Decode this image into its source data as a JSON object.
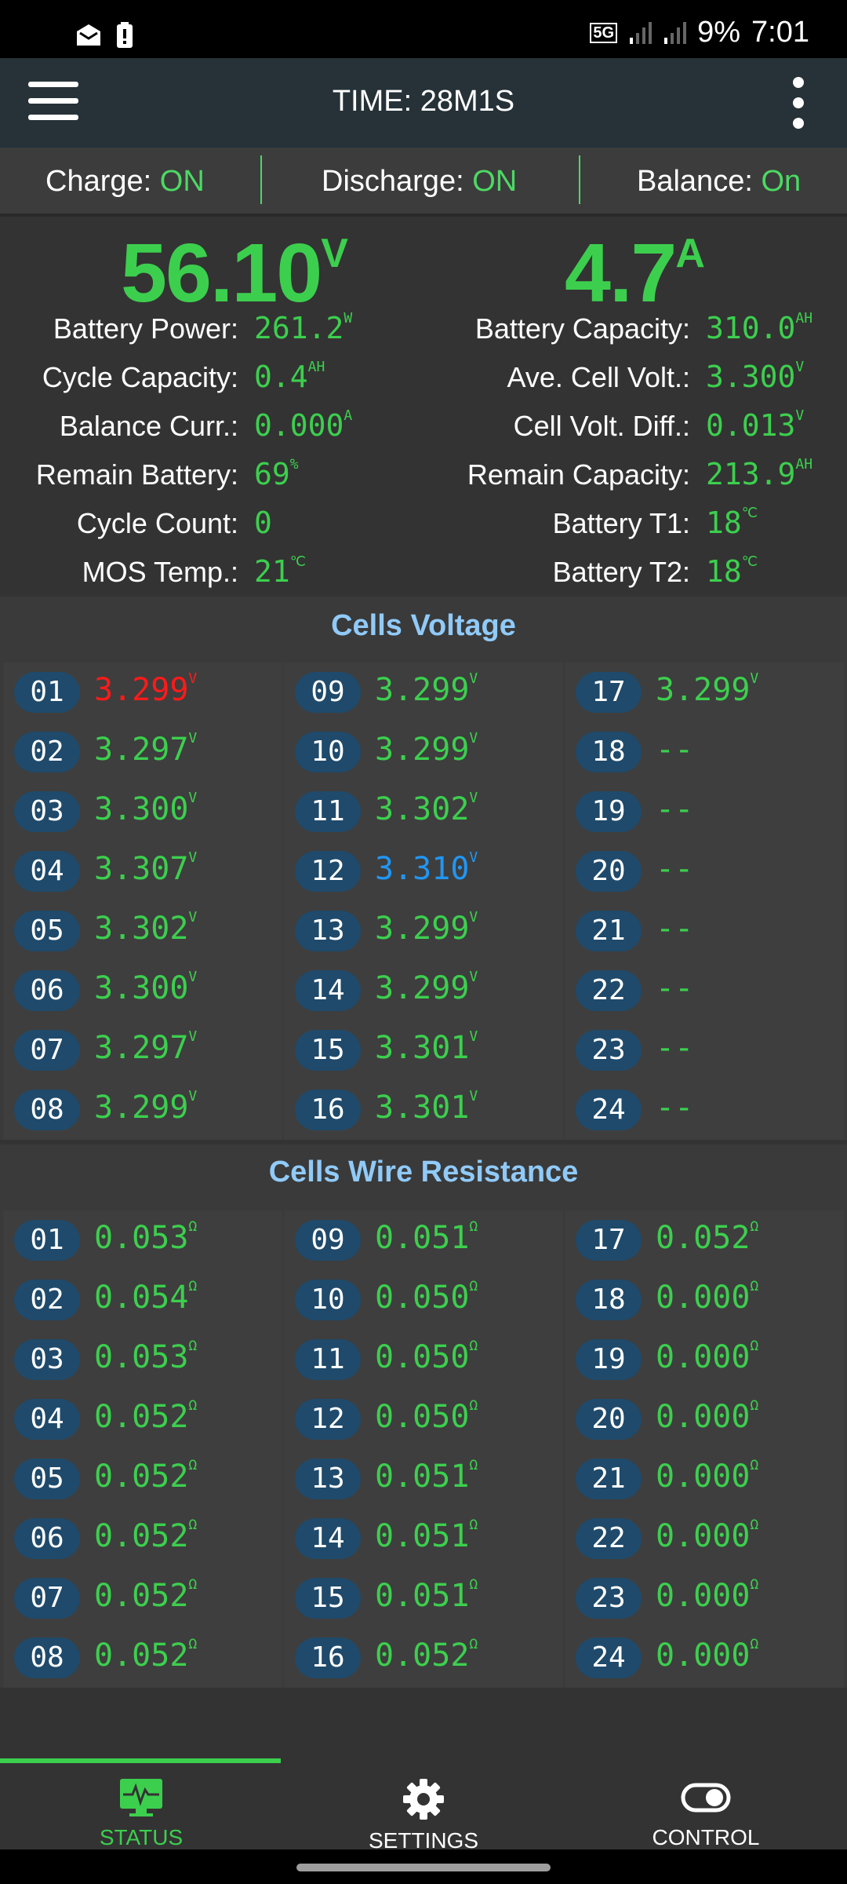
{
  "statusbar": {
    "network": "5G",
    "battery": "9%",
    "time": "7:01"
  },
  "appbar": {
    "title": "TIME: 28M1S"
  },
  "switches": {
    "charge_label": "Charge:",
    "charge_value": "ON",
    "discharge_label": "Discharge:",
    "discharge_value": "ON",
    "balance_label": "Balance:",
    "balance_value": "On"
  },
  "readings": {
    "voltage": "56.10",
    "voltage_unit": "V",
    "current": "4.7",
    "current_unit": "A"
  },
  "left_stats": [
    {
      "label": "Battery Power:",
      "value": "261.2",
      "unit": "W"
    },
    {
      "label": "Cycle Capacity:",
      "value": "0.4",
      "unit": "AH"
    },
    {
      "label": "Balance Curr.:",
      "value": "0.000",
      "unit": "A"
    },
    {
      "label": "Remain Battery:",
      "value": "69",
      "unit": "%"
    },
    {
      "label": "Cycle Count:",
      "value": "0",
      "unit": ""
    },
    {
      "label": "MOS Temp.:",
      "value": "21",
      "unit": "℃"
    }
  ],
  "right_stats": [
    {
      "label": "Battery Capacity:",
      "value": "310.0",
      "unit": "AH"
    },
    {
      "label": "Ave. Cell Volt.:",
      "value": "3.300",
      "unit": "V"
    },
    {
      "label": "Cell Volt. Diff.:",
      "value": "0.013",
      "unit": "V"
    },
    {
      "label": "Remain Capacity:",
      "value": "213.9",
      "unit": "AH"
    },
    {
      "label": "Battery T1:",
      "value": "18",
      "unit": "℃"
    },
    {
      "label": "Battery T2:",
      "value": "18",
      "unit": "℃"
    }
  ],
  "cells_voltage": {
    "title": "Cells Voltage",
    "unit": "V",
    "cells": [
      {
        "id": "01",
        "value": "3.299",
        "state": "min"
      },
      {
        "id": "02",
        "value": "3.297"
      },
      {
        "id": "03",
        "value": "3.300"
      },
      {
        "id": "04",
        "value": "3.307"
      },
      {
        "id": "05",
        "value": "3.302"
      },
      {
        "id": "06",
        "value": "3.300"
      },
      {
        "id": "07",
        "value": "3.297"
      },
      {
        "id": "08",
        "value": "3.299"
      },
      {
        "id": "09",
        "value": "3.299"
      },
      {
        "id": "10",
        "value": "3.299"
      },
      {
        "id": "11",
        "value": "3.302"
      },
      {
        "id": "12",
        "value": "3.310",
        "state": "max"
      },
      {
        "id": "13",
        "value": "3.299"
      },
      {
        "id": "14",
        "value": "3.299"
      },
      {
        "id": "15",
        "value": "3.301"
      },
      {
        "id": "16",
        "value": "3.301"
      },
      {
        "id": "17",
        "value": "3.299"
      },
      {
        "id": "18",
        "value": "--"
      },
      {
        "id": "19",
        "value": "--"
      },
      {
        "id": "20",
        "value": "--"
      },
      {
        "id": "21",
        "value": "--"
      },
      {
        "id": "22",
        "value": "--"
      },
      {
        "id": "23",
        "value": "--"
      },
      {
        "id": "24",
        "value": "--"
      }
    ]
  },
  "cells_resistance": {
    "title": "Cells Wire Resistance",
    "unit": "Ω",
    "cells": [
      {
        "id": "01",
        "value": "0.053"
      },
      {
        "id": "02",
        "value": "0.054"
      },
      {
        "id": "03",
        "value": "0.053"
      },
      {
        "id": "04",
        "value": "0.052"
      },
      {
        "id": "05",
        "value": "0.052"
      },
      {
        "id": "06",
        "value": "0.052"
      },
      {
        "id": "07",
        "value": "0.052"
      },
      {
        "id": "08",
        "value": "0.052"
      },
      {
        "id": "09",
        "value": "0.051"
      },
      {
        "id": "10",
        "value": "0.050"
      },
      {
        "id": "11",
        "value": "0.050"
      },
      {
        "id": "12",
        "value": "0.050"
      },
      {
        "id": "13",
        "value": "0.051"
      },
      {
        "id": "14",
        "value": "0.051"
      },
      {
        "id": "15",
        "value": "0.051"
      },
      {
        "id": "16",
        "value": "0.052"
      },
      {
        "id": "17",
        "value": "0.052"
      },
      {
        "id": "18",
        "value": "0.000"
      },
      {
        "id": "19",
        "value": "0.000"
      },
      {
        "id": "20",
        "value": "0.000"
      },
      {
        "id": "21",
        "value": "0.000"
      },
      {
        "id": "22",
        "value": "0.000"
      },
      {
        "id": "23",
        "value": "0.000"
      },
      {
        "id": "24",
        "value": "0.000"
      }
    ]
  },
  "nav": {
    "items": [
      {
        "label": "STATUS",
        "icon": "status-monitor-icon",
        "active": true
      },
      {
        "label": "SETTINGS",
        "icon": "gear-icon"
      },
      {
        "label": "CONTROL",
        "icon": "toggle-icon"
      }
    ]
  },
  "colors": {
    "accent_green": "#3ccf4e",
    "min_cell_red": "#ff1a1a",
    "max_cell_blue": "#2196f3",
    "section_title_blue": "#90caf9",
    "appbar_bg": "#263238",
    "badge_bg": "#1f4a6b"
  }
}
